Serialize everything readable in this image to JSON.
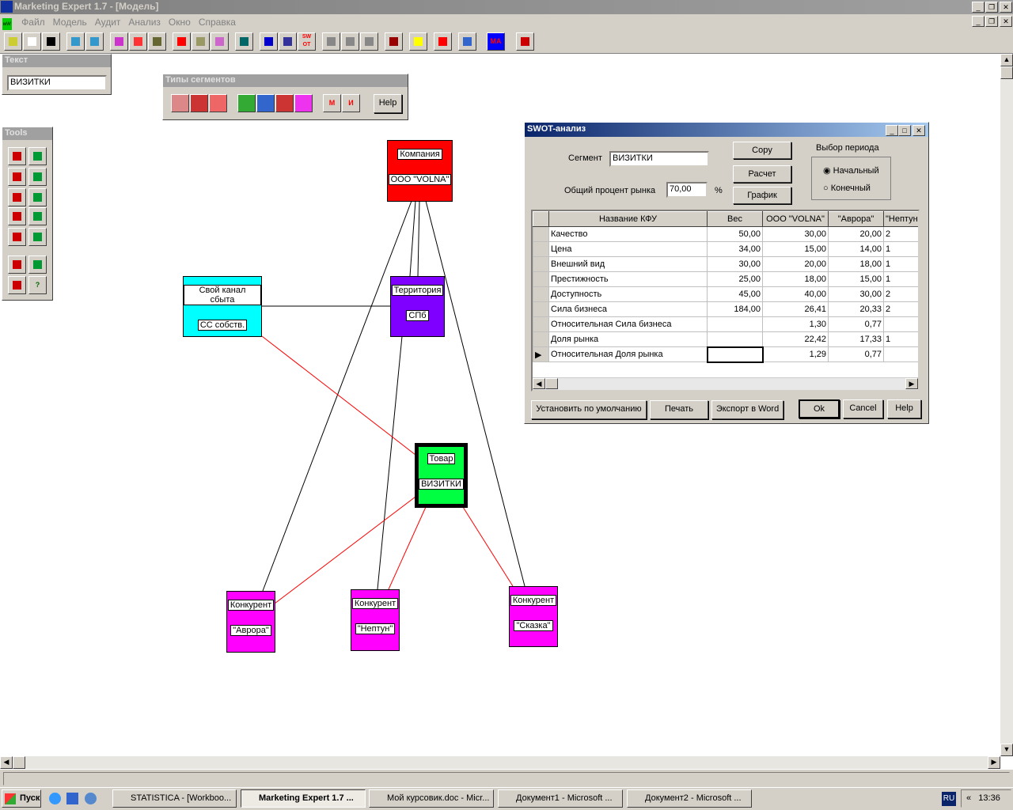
{
  "window": {
    "title": "Marketing Expert 1.7 - [Модель]"
  },
  "menu": [
    "Файл",
    "Модель",
    "Аудит",
    "Анализ",
    "Окно",
    "Справка"
  ],
  "text_panel": {
    "title": "Текст",
    "value": "ВИЗИТКИ"
  },
  "segment_types_panel": {
    "title": "Типы сегментов",
    "help": "Help"
  },
  "tools_panel": {
    "title": "Tools",
    "help_glyph": "?"
  },
  "toolbar_icons": [
    "open-icon",
    "copy-icon",
    "arrow-right-icon",
    "import-icon",
    "export-icon",
    "tree-icon",
    "forward-icon",
    "tools-icon",
    "clock-icon",
    "money-icon",
    "chart-icon",
    "calculator-icon",
    "k-icon",
    "briefcase-icon",
    "swot-icon",
    "bars-icon",
    "split-icon",
    "undo-icon",
    "glasses-icon",
    "lightning-icon",
    "squares-icon",
    "book-icon",
    "ma-icon",
    "exit-icon"
  ],
  "toolbar_labels": {
    "swot": "SW OT",
    "ma": "MA"
  },
  "diagram": {
    "company": {
      "label": "Компания",
      "value": "ООО \"VOLNA\""
    },
    "channel": {
      "label": "Свой канал сбыта",
      "value": "СС собств."
    },
    "territory": {
      "label": "Территория",
      "value": "СПб"
    },
    "product": {
      "label": "Товар",
      "value": "ВИЗИТКИ"
    },
    "competitors": [
      {
        "label": "Конкурент",
        "value": "\"Аврора\""
      },
      {
        "label": "Конкурент",
        "value": "\"Нептун\""
      },
      {
        "label": "Конкурент",
        "value": "\"Сказка\""
      }
    ]
  },
  "swot": {
    "title": "SWOT-анализ",
    "segment_label": "Сегмент",
    "segment_value": "ВИЗИТКИ",
    "market_label": "Общий процент рынка",
    "market_value": "70,00",
    "percent": "%",
    "buttons": {
      "copy": "Copy",
      "calc": "Расчет",
      "graph": "График",
      "default": "Установить по умолчанию",
      "print": "Печать",
      "export": "Экспорт в Word",
      "ok": "Ok",
      "cancel": "Cancel",
      "help": "Help"
    },
    "period": {
      "title": "Выбор периода",
      "options": [
        "Начальный",
        "Конечный"
      ],
      "selected": "Начальный"
    },
    "columns": [
      "Название КФУ",
      "Вес",
      "ООО \"VOLNA\"",
      "\"Аврора\"",
      "\"Нептун\""
    ],
    "rows": [
      [
        "Качество",
        "50,00",
        "30,00",
        "20,00",
        "2"
      ],
      [
        "Цена",
        "34,00",
        "15,00",
        "14,00",
        "1"
      ],
      [
        "Внешний вид",
        "30,00",
        "20,00",
        "18,00",
        "1"
      ],
      [
        "Престижность",
        "25,00",
        "18,00",
        "15,00",
        "1"
      ],
      [
        "Доступность",
        "45,00",
        "40,00",
        "30,00",
        "2"
      ],
      [
        "Сила бизнеса",
        "184,00",
        "26,41",
        "20,33",
        "2"
      ],
      [
        "Относительная Сила бизнеса",
        "",
        "1,30",
        "0,77",
        ""
      ],
      [
        "Доля рынка",
        "",
        "22,42",
        "17,33",
        "1"
      ],
      [
        "Относительная Доля рынка",
        "",
        "1,29",
        "0,77",
        ""
      ]
    ]
  },
  "taskbar": {
    "start": "Пуск",
    "tasks": [
      "STATISTICA - [Workboo...",
      "Marketing Expert 1.7 ...",
      "Мой курсовик.doc - Micr...",
      "Документ1 - Microsoft ...",
      "Документ2 - Microsoft ..."
    ],
    "lang": "RU",
    "clock": "13:36"
  }
}
